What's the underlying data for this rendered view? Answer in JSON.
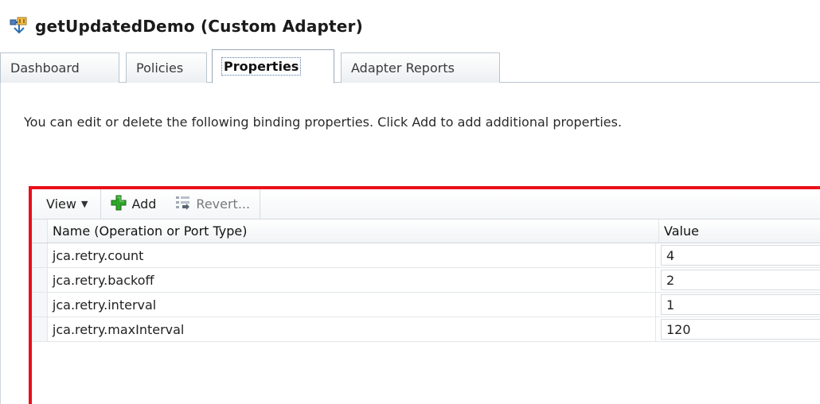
{
  "title": {
    "icon": "adapter-plug-icon",
    "text": "getUpdatedDemo (Custom Adapter)"
  },
  "tabs": [
    {
      "label": "Dashboard",
      "active": false
    },
    {
      "label": "Policies",
      "active": false
    },
    {
      "label": "Properties",
      "active": true
    },
    {
      "label": "Adapter Reports",
      "active": false
    }
  ],
  "instructions": "You can edit or delete the following binding properties. Click Add to add additional properties.",
  "toolbar": {
    "view_label": "View",
    "add_label": "Add",
    "add_icon": "green-plus-icon",
    "revert_label": "Revert...",
    "revert_icon": "revert-icon"
  },
  "table": {
    "columns": [
      "Name (Operation or Port Type)",
      "Value"
    ],
    "rows": [
      {
        "name": "jca.retry.count",
        "value": "4"
      },
      {
        "name": "jca.retry.backoff",
        "value": "2"
      },
      {
        "name": "jca.retry.interval",
        "value": "1"
      },
      {
        "name": "jca.retry.maxInterval",
        "value": "120"
      }
    ]
  },
  "colors": {
    "highlight_border": "#e8101a",
    "add_icon_green": "#2ea62a"
  }
}
